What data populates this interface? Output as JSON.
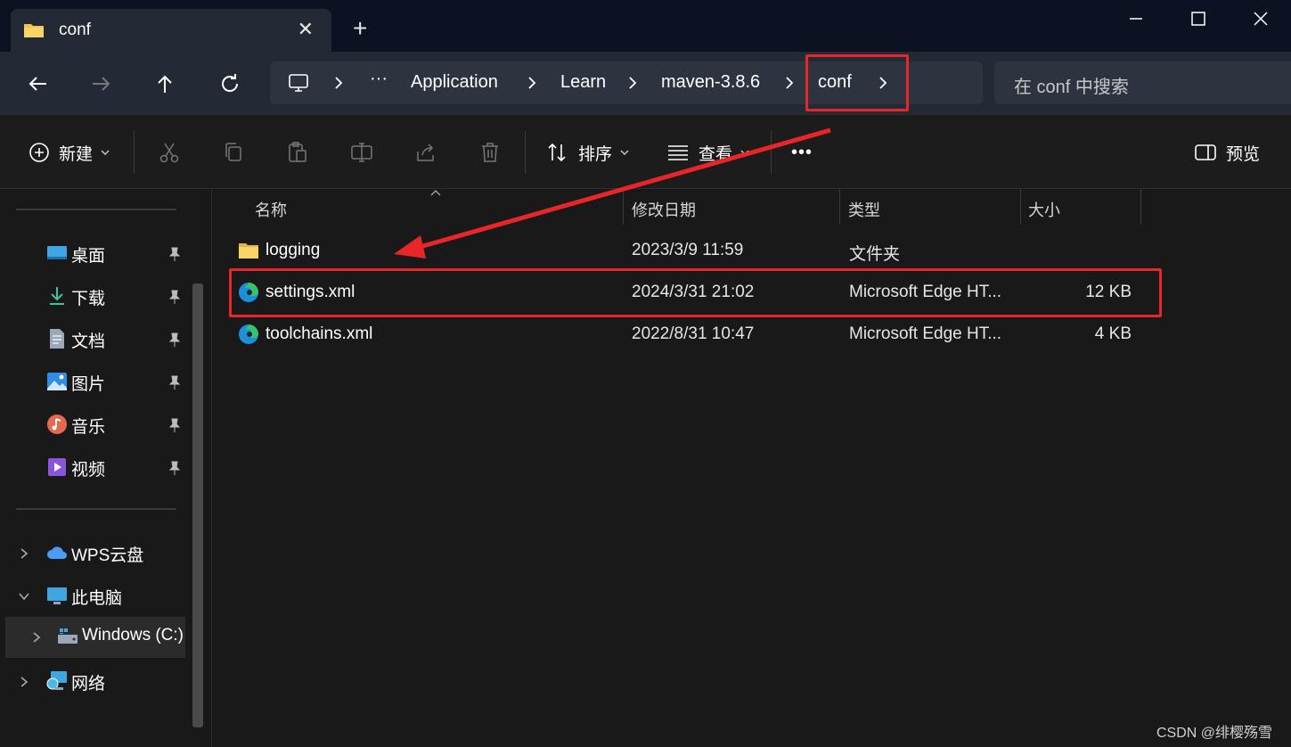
{
  "tab": {
    "title": "conf"
  },
  "address": {
    "ellipsis": "···",
    "crumbs": [
      "Application",
      "Learn",
      "maven-3.8.6",
      "conf"
    ]
  },
  "search": {
    "placeholder": "在 conf 中搜索"
  },
  "toolbar": {
    "new_label": "新建",
    "sort_label": "排序",
    "view_label": "查看",
    "more_label": "•••",
    "preview_label": "预览"
  },
  "sidebar": {
    "quick": [
      {
        "label": "桌面",
        "icon": "desktop-icon"
      },
      {
        "label": "下载",
        "icon": "download-icon"
      },
      {
        "label": "文档",
        "icon": "document-icon"
      },
      {
        "label": "图片",
        "icon": "picture-icon"
      },
      {
        "label": "音乐",
        "icon": "music-icon"
      },
      {
        "label": "视频",
        "icon": "video-icon"
      }
    ],
    "tree": [
      {
        "label": "WPS云盘",
        "icon": "cloud-icon"
      },
      {
        "label": "此电脑",
        "icon": "computer-icon"
      },
      {
        "label": "Windows (C:)",
        "icon": "drive-icon"
      },
      {
        "label": "网络",
        "icon": "network-icon"
      }
    ]
  },
  "columns": [
    "名称",
    "修改日期",
    "类型",
    "大小"
  ],
  "files": [
    {
      "name": "logging",
      "date": "2023/3/9 11:59",
      "type": "文件夹",
      "size": "",
      "icon": "folder-icon"
    },
    {
      "name": "settings.xml",
      "date": "2024/3/31 21:02",
      "type": "Microsoft Edge HT...",
      "size": "12 KB",
      "icon": "edge-icon"
    },
    {
      "name": "toolchains.xml",
      "date": "2022/8/31 10:47",
      "type": "Microsoft Edge HT...",
      "size": "4 KB",
      "icon": "edge-icon"
    }
  ],
  "watermark": "CSDN @绯樱殇雪",
  "colors": {
    "highlight": "#e8262a",
    "titlebar": "#0b1322",
    "navbar": "#232a35"
  }
}
